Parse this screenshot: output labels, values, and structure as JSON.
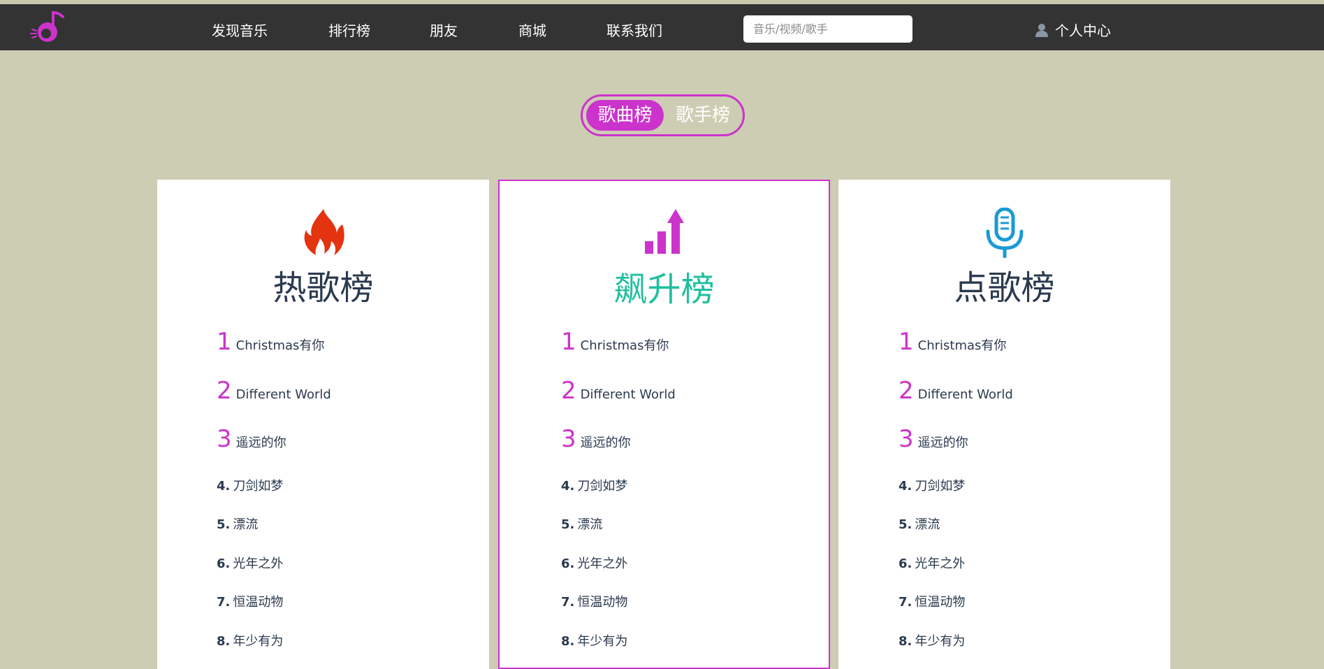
{
  "header": {
    "nav": [
      "发现音乐",
      "排行榜",
      "朋友",
      "商城",
      "联系我们"
    ],
    "search_placeholder": "音乐/视频/歌手",
    "user_label": "个人中心"
  },
  "toggle": {
    "active": "歌曲榜",
    "inactive": "歌手榜"
  },
  "colors": {
    "accent": "#cc33cc",
    "teal": "#1ebf9e",
    "background": "#cdcdb4",
    "topbar": "#333333"
  },
  "charts": [
    {
      "title": "热歌榜",
      "icon": "fire-icon",
      "songs": [
        {
          "rank": "1",
          "name": "Christmas有你"
        },
        {
          "rank": "2",
          "name": "Different World"
        },
        {
          "rank": "3",
          "name": "遥远的你"
        },
        {
          "rank": "4.",
          "name": "刀剑如梦"
        },
        {
          "rank": "5.",
          "name": "漂流"
        },
        {
          "rank": "6.",
          "name": "光年之外"
        },
        {
          "rank": "7.",
          "name": "恒温动物"
        },
        {
          "rank": "8.",
          "name": "年少有为"
        }
      ]
    },
    {
      "title": "飙升榜",
      "icon": "rising-bars-icon",
      "songs": [
        {
          "rank": "1",
          "name": "Christmas有你"
        },
        {
          "rank": "2",
          "name": "Different World"
        },
        {
          "rank": "3",
          "name": "遥远的你"
        },
        {
          "rank": "4.",
          "name": "刀剑如梦"
        },
        {
          "rank": "5.",
          "name": "漂流"
        },
        {
          "rank": "6.",
          "name": "光年之外"
        },
        {
          "rank": "7.",
          "name": "恒温动物"
        },
        {
          "rank": "8.",
          "name": "年少有为"
        }
      ]
    },
    {
      "title": "点歌榜",
      "icon": "microphone-icon",
      "songs": [
        {
          "rank": "1",
          "name": "Christmas有你"
        },
        {
          "rank": "2",
          "name": "Different World"
        },
        {
          "rank": "3",
          "name": "遥远的你"
        },
        {
          "rank": "4.",
          "name": "刀剑如梦"
        },
        {
          "rank": "5.",
          "name": "漂流"
        },
        {
          "rank": "6.",
          "name": "光年之外"
        },
        {
          "rank": "7.",
          "name": "恒温动物"
        },
        {
          "rank": "8.",
          "name": "年少有为"
        }
      ]
    }
  ]
}
